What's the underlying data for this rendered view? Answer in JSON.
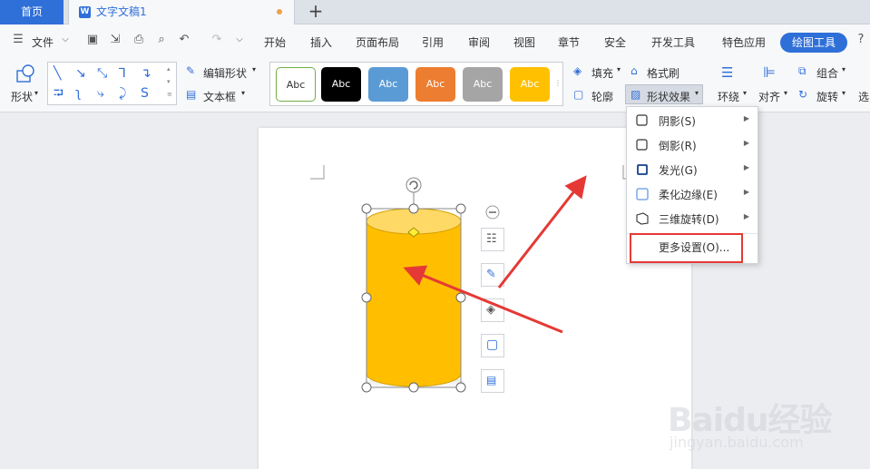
{
  "tabs": {
    "home": "首页",
    "document": "文字文稿1",
    "new_tab_icon": "plus-icon"
  },
  "menu": {
    "file": "文件",
    "items": [
      "开始",
      "插入",
      "页面布局",
      "引用",
      "审阅",
      "视图",
      "章节",
      "安全",
      "开发工具",
      "特色应用"
    ],
    "active": "绘图工具"
  },
  "ribbon": {
    "shape": "形状",
    "edit_shape": "编辑形状",
    "text_box": "文本框",
    "style_label": "Abc",
    "style_colors": [
      "#ffffff",
      "#000000",
      "#5b9bd5",
      "#ed7d31",
      "#a5a5a5",
      "#ffc000"
    ],
    "fill": "填充",
    "format_painter": "格式刷",
    "outline": "轮廓",
    "shape_effects": "形状效果",
    "wrap": "环绕",
    "align": "对齐",
    "group": "组合",
    "rotate": "旋转",
    "select": "选"
  },
  "effects_menu": {
    "items": [
      {
        "label": "阴影(S)",
        "icon": "shadow-icon",
        "submenu": true
      },
      {
        "label": "倒影(R)",
        "icon": "reflection-icon",
        "submenu": true
      },
      {
        "label": "发光(G)",
        "icon": "glow-icon",
        "submenu": true
      },
      {
        "label": "柔化边缘(E)",
        "icon": "soft-edge-icon",
        "submenu": true
      },
      {
        "label": "三维旋转(D)",
        "icon": "3d-rotation-icon",
        "submenu": true
      }
    ],
    "more": "更多设置(O)..."
  },
  "shape": {
    "type": "cylinder",
    "fill": "#ffbf00",
    "top_fill": "#ffd966"
  },
  "colors": {
    "accent": "#2f6fd8",
    "arrow": "#e53935"
  },
  "watermark": {
    "brand": "Baidu经验",
    "url": "jingyan.baidu.com"
  }
}
